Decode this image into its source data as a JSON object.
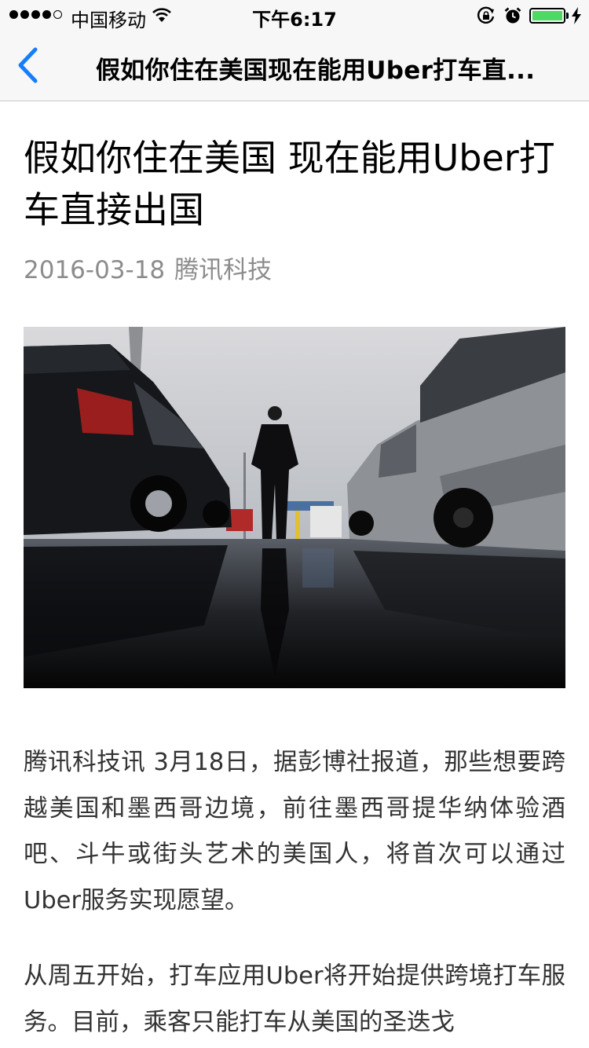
{
  "status_bar": {
    "carrier": "中国移动",
    "time": "下午6:17",
    "battery_level": 1.0,
    "signal_bars": 4,
    "signal_total": 5
  },
  "nav": {
    "title": "假如你住在美国现在能用Uber打车直..."
  },
  "article": {
    "title": "假如你住在美国 现在能用Uber打车直接出国",
    "date": "2016-03-18",
    "source": "腾讯科技",
    "paragraphs": [
      "腾讯科技讯 3月18日，据彭博社报道，那些想要跨越美国和墨西哥边境，前往墨西哥提华纳体验酒吧、斗牛或街头艺术的美国人，将首次可以通过Uber服务实现愿望。",
      "从周五开始，打车应用Uber将开始提供跨境打车服务。目前，乘客只能打车从美国的圣迭戈"
    ]
  },
  "colors": {
    "ios_blue": "#157efb",
    "battery_green": "#4cd964",
    "meta_gray": "#8c8c8c",
    "body_text": "#333333"
  }
}
